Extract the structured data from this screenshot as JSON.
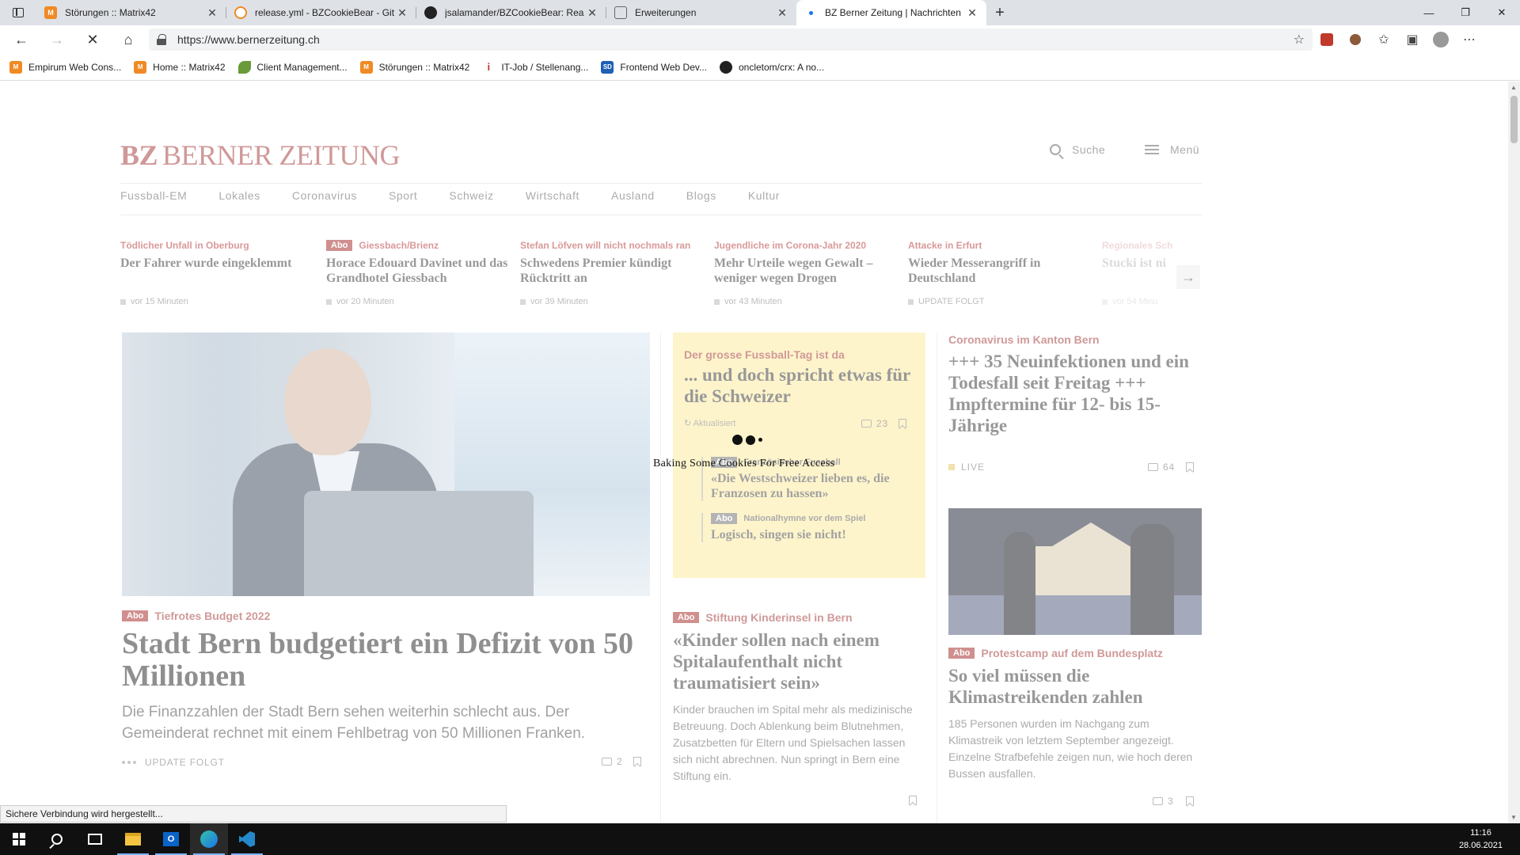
{
  "browser": {
    "tabs": [
      {
        "title": "Störungen :: Matrix42",
        "icon": "matrix42-icon",
        "color": "#f08a24",
        "active": false
      },
      {
        "title": "release.yml - BZCookieBear - Git",
        "icon": "git-icon",
        "color": "#f08a24",
        "active": false
      },
      {
        "title": "jsalamander/BZCookieBear: Rea",
        "icon": "github-icon",
        "color": "#222222",
        "active": false
      },
      {
        "title": "Erweiterungen",
        "icon": "extension-icon",
        "color": "#666666",
        "active": false
      },
      {
        "title": "BZ Berner Zeitung | Nachrichten",
        "icon": "loading-icon",
        "color": "#1a73e8",
        "active": true
      }
    ],
    "url": "https://www.bernerzeitung.ch",
    "bookmarks": [
      {
        "label": "Empirum Web Cons...",
        "icon": "matrix42-icon",
        "color": "#f08a24"
      },
      {
        "label": "Home :: Matrix42",
        "icon": "matrix42-icon",
        "color": "#f08a24"
      },
      {
        "label": "Client Management...",
        "icon": "leaf-icon",
        "color": "#6a9a3a"
      },
      {
        "label": "Störungen :: Matrix42",
        "icon": "matrix42-icon",
        "color": "#f08a24"
      },
      {
        "label": "IT-Job / Stellenang...",
        "icon": "info-icon",
        "color": "#c0392b"
      },
      {
        "label": "Frontend Web Dev...",
        "icon": "sd-icon",
        "color": "#1f5fb4"
      },
      {
        "label": "oncletom/crx: A no...",
        "icon": "github-icon",
        "color": "#222222"
      }
    ],
    "status": "Sichere Verbindung wird hergestellt..."
  },
  "site": {
    "logo_bz": "BZ",
    "logo_name": "BERNER ZEITUNG",
    "search_label": "Suche",
    "menu_label": "Menü",
    "sections": [
      "Fussball-EM",
      "Lokales",
      "Coronavirus",
      "Sport",
      "Schweiz",
      "Wirtschaft",
      "Ausland",
      "Blogs",
      "Kultur"
    ],
    "abo_label": "Abo",
    "ticker": [
      {
        "kicker": "Tödlicher Unfall in Oberburg",
        "title": "Der Fahrer wurde eingeklemmt",
        "time": "vor 15 Minuten",
        "abo": false
      },
      {
        "kicker": "Giessbach/Brienz",
        "title": "Horace Edouard Davinet und das Grandhotel Giessbach",
        "time": "vor 20 Minuten",
        "abo": true
      },
      {
        "kicker": "Stefan Löfven will nicht nochmals ran",
        "title": "Schwedens Premier kündigt Rücktritt an",
        "time": "vor 39 Minuten",
        "abo": false
      },
      {
        "kicker": "Jugendliche im Corona-Jahr 2020",
        "title": "Mehr Urteile wegen Gewalt – weniger wegen Drogen",
        "time": "vor 43 Minuten",
        "abo": false
      },
      {
        "kicker": "Attacke in Erfurt",
        "title": "Wieder Messerangriff in Deutschland",
        "time": "UPDATE FOLGT",
        "abo": false
      },
      {
        "kicker": "Regionales Sch",
        "title": "Stucki ist ni",
        "time": "vor 54 Minu",
        "abo": false
      }
    ],
    "lead": {
      "kicker": "Tiefrotes Budget 2022",
      "title": "Stadt Bern budgetiert ein Defizit von 50 Millionen",
      "teaser": "Die Finanzzahlen der Stadt Bern sehen weiterhin schlecht aus. Der Gemeinderat rechnet mit einem Fehlbetrag von 50 Millionen Franken.",
      "status": "UPDATE FOLGT",
      "comments": "2"
    },
    "focus": {
      "kicker": "Der grosse Fussball-Tag ist da",
      "title": "... und doch spricht etwas für die Schweizer",
      "updated": "Aktualisiert",
      "comments": "23",
      "sub1_kicker": "Französischer Fussball",
      "sub1_title": "«Die Westschweizer lieben es, die Franzosen zu hassen»",
      "sub2_kicker": "Nationalhymne vor dem Spiel",
      "sub2_title": "Logisch, singen sie nicht!"
    },
    "story2": {
      "kicker": "Stiftung Kinderinsel in Bern",
      "title": "«Kinder sollen nach einem Spitalaufenthalt nicht traumatisiert sein»",
      "teaser": "Kinder brauchen im Spital mehr als medizinische Betreuung. Doch Ablenkung beim Blutnehmen, Zusatzbetten für Eltern und Spielsachen lassen sich nicht abrechnen. Nun springt in Bern eine Stiftung ein."
    },
    "story3": {
      "kicker": "Coronavirus im Kanton Bern",
      "title": "+++ 35 Neuinfektionen und ein Todesfall seit Freitag +++ Impftermine für 12- bis 15-Jährige",
      "live": "LIVE",
      "comments": "64"
    },
    "story4": {
      "kicker": "Protestcamp auf dem Bundesplatz",
      "title": "So viel müssen die Klimastreikenden zahlen",
      "teaser": "185 Personen wurden im Nachgang zum Klimastreik von letztem September angezeigt. Einzelne Strafbefehle zeigen nun, wie hoch deren Bussen ausfallen.",
      "comments": "3"
    },
    "overlay_text": "Baking Some Cookies For Free Access"
  },
  "taskbar": {
    "time": "11:16",
    "date": "28.06.2021",
    "apps": [
      "start-icon",
      "search-icon",
      "task-view-icon",
      "file-explorer-icon",
      "outlook-icon",
      "edge-icon",
      "vscode-icon"
    ]
  }
}
